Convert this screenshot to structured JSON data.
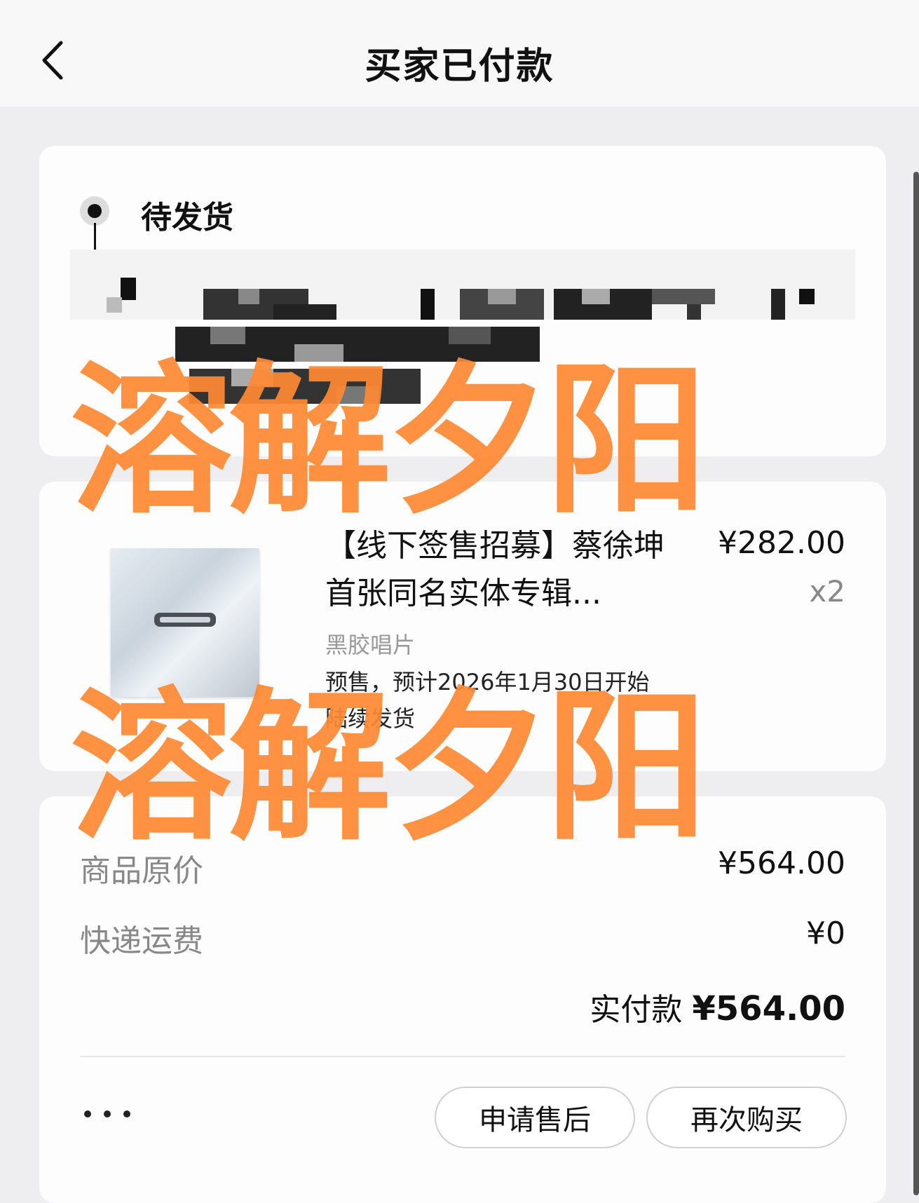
{
  "header": {
    "title": "买家已付款",
    "back_icon": "chevron-left-icon"
  },
  "status": {
    "label": "待发货"
  },
  "product": {
    "name": "【线下签售招募】蔡徐坤首张同名实体专辑...",
    "price": "¥282.00",
    "quantity": "x2",
    "variant": "黑胶唱片",
    "presale_note": "预售，预计2026年1月30日开始陆续发货"
  },
  "summary": {
    "original_price_label": "商品原价",
    "original_price_value": "¥564.00",
    "shipping_label": "快递运费",
    "shipping_value": "¥0",
    "paid_label": "实付款",
    "paid_value": "¥564.00"
  },
  "actions": {
    "more_icon": "more-dots-icon",
    "after_sale": "申请售后",
    "buy_again": "再次购买"
  },
  "watermark": {
    "text": "溶解夕阳"
  },
  "colors": {
    "watermark": "#ff8a33",
    "background": "#eeeef0",
    "card": "#fdfdfd"
  }
}
